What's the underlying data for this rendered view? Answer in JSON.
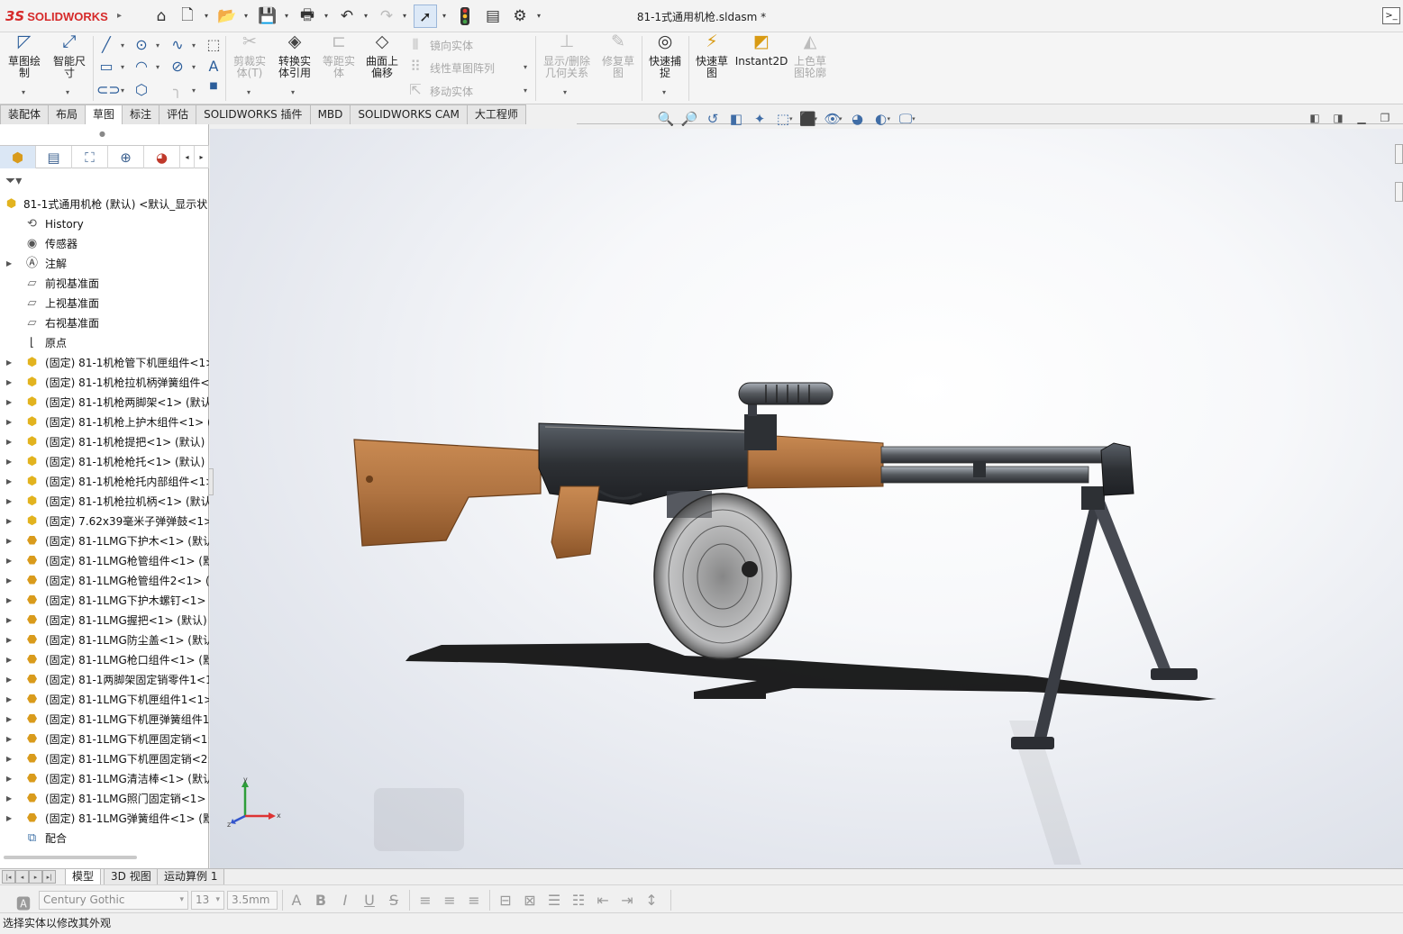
{
  "app": {
    "brand_mark": "3S",
    "brand_name": "SOLIDWORKS"
  },
  "document": {
    "title": "81-1式通用机枪.sldasm *"
  },
  "quick_access": [
    "home-icon",
    "new-file-icon",
    "open-file-icon",
    "save-icon",
    "print-icon",
    "undo-icon",
    "redo-icon",
    "select-arrow-icon",
    "traffic-light-icon",
    "file-properties-icon",
    "gear-icon"
  ],
  "ribbon": {
    "sketch": "草图绘\n制",
    "smart_dim": "智能尺\n寸",
    "trim": "剪裁实\n体(T)",
    "convert": "转换实\n体引用",
    "offset_entities": "等距实\n体",
    "offset_surface": "曲面上\n偏移",
    "mirror": "镜向实体",
    "linear_pattern": "线性草图阵列",
    "move": "移动实体",
    "display_relations": "显示/删除\n几何关系",
    "repair": "修复草\n图",
    "quick_snaps": "快速捕\n捉",
    "rapid_sketch": "快速草\n图",
    "instant2d": "Instant2D",
    "shaded_contours": "上色草\n图轮廓"
  },
  "tabs": [
    "装配体",
    "布局",
    "草图",
    "标注",
    "评估",
    "SOLIDWORKS 插件",
    "MBD",
    "SOLIDWORKS CAM",
    "大工程师"
  ],
  "active_tab": "草图",
  "tree": {
    "root": "81-1式通用机枪 (默认) <默认_显示状",
    "fixed_items": [
      {
        "label": "History",
        "icon": "history-icon"
      },
      {
        "label": "传感器",
        "icon": "sensor-icon"
      },
      {
        "label": "注解",
        "icon": "annotation-icon"
      },
      {
        "label": "前视基准面",
        "icon": "plane-icon"
      },
      {
        "label": "上视基准面",
        "icon": "plane-icon"
      },
      {
        "label": "右视基准面",
        "icon": "plane-icon"
      },
      {
        "label": "原点",
        "icon": "origin-icon"
      }
    ],
    "components": [
      {
        "label": "(固定) 81-1机枪管下机匣组件<1>",
        "type": "assembly"
      },
      {
        "label": "(固定) 81-1机枪拉机柄弹簧组件<",
        "type": "assembly"
      },
      {
        "label": "(固定) 81-1机枪两脚架<1> (默认",
        "type": "assembly"
      },
      {
        "label": "(固定) 81-1机枪上护木组件<1> (",
        "type": "assembly"
      },
      {
        "label": "(固定) 81-1机枪提把<1> (默认) <",
        "type": "assembly"
      },
      {
        "label": "(固定) 81-1机枪枪托<1> (默认) <",
        "type": "assembly"
      },
      {
        "label": "(固定) 81-1机枪枪托内部组件<1>",
        "type": "assembly"
      },
      {
        "label": "(固定) 81-1机枪拉机柄<1> (默认",
        "type": "assembly"
      },
      {
        "label": "(固定) 7.62x39毫米子弹弹鼓<1>",
        "type": "assembly"
      },
      {
        "label": "(固定) 81-1LMG下护木<1> (默认",
        "type": "part"
      },
      {
        "label": "(固定) 81-1LMG枪管组件<1> (默",
        "type": "part"
      },
      {
        "label": "(固定) 81-1LMG枪管组件2<1> (默",
        "type": "part"
      },
      {
        "label": "(固定) 81-1LMG下护木螺钉<1> (",
        "type": "part"
      },
      {
        "label": "(固定) 81-1LMG握把<1> (默认)",
        "type": "part"
      },
      {
        "label": "(固定) 81-1LMG防尘盖<1> (默认",
        "type": "part"
      },
      {
        "label": "(固定) 81-1LMG枪口组件<1> (默",
        "type": "part"
      },
      {
        "label": "(固定) 81-1两脚架固定销零件1<1",
        "type": "part"
      },
      {
        "label": "(固定) 81-1LMG下机匣组件1<1>",
        "type": "part"
      },
      {
        "label": "(固定) 81-1LMG下机匣弹簧组件1",
        "type": "part"
      },
      {
        "label": "(固定) 81-1LMG下机匣固定销<1:",
        "type": "part"
      },
      {
        "label": "(固定) 81-1LMG下机匣固定销<2:",
        "type": "part"
      },
      {
        "label": "(固定) 81-1LMG清洁棒<1> (默认",
        "type": "part"
      },
      {
        "label": "(固定) 81-1LMG照门固定销<1> (",
        "type": "part"
      },
      {
        "label": "(固定) 81-1LMG弹簧组件<1> (默",
        "type": "part"
      }
    ],
    "mates": "配合"
  },
  "triad": {
    "x": "x",
    "y": "y",
    "z": "z"
  },
  "bottom_tabs": [
    "模型",
    "3D 视图",
    "运动算例 1"
  ],
  "format_bar": {
    "font": "Century Gothic",
    "size": "13",
    "height": "3.5mm"
  },
  "status": "选择实体以修改其外观",
  "colors": {
    "wood": "#b07442",
    "metal": "#2d3034",
    "accent_red": "#d62a2a",
    "selection_blue": "#dde9f7"
  }
}
